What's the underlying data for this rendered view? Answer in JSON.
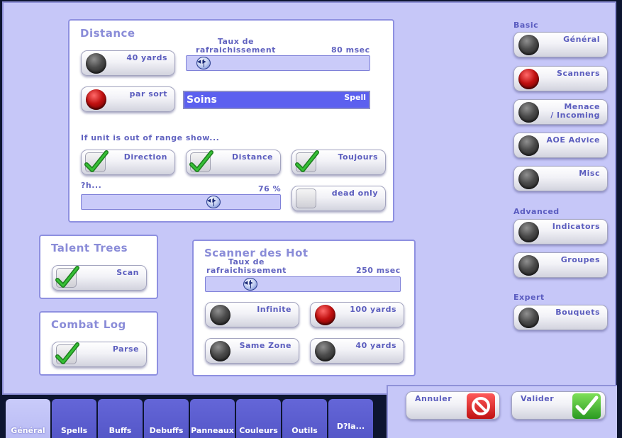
{
  "distance": {
    "title": "Distance",
    "btn_40yards": "40 yards",
    "btn_par_sort": "par sort",
    "refresh_label": "Taux de\nrafraichissement",
    "refresh_value": "80 msec",
    "refresh_level": 0.03,
    "spell_value": "Soins",
    "spell_tag": "Spell",
    "out_of_range_label": "If unit is out of range show...",
    "btn_direction": "Direction",
    "btn_distance": "Distance",
    "btn_toujours": "Toujours",
    "alpha_label": "?h...",
    "alpha_value": "76 %",
    "alpha_level": 0.76,
    "btn_dead_only": "dead only"
  },
  "talent_trees": {
    "title": "Talent Trees",
    "btn_scan": "Scan"
  },
  "combat_log": {
    "title": "Combat Log",
    "btn_parse": "Parse"
  },
  "scanner_hot": {
    "title": "Scanner des Hot",
    "refresh_label": "Taux de\nrafraichissement",
    "refresh_value": "250 msec",
    "refresh_level": 0.2,
    "btn_infinite": "Infinite",
    "btn_100yards": "100 yards",
    "btn_same_zone": "Same Zone",
    "btn_40yards": "40 yards"
  },
  "sidebar": {
    "basic_label": "Basic",
    "advanced_label": "Advanced",
    "expert_label": "Expert",
    "general": "Général",
    "scanners": "Scanners",
    "menace": "Menace\n/ Incoming",
    "aoe": "AOE Advice",
    "misc": "Misc",
    "indicators": "Indicators",
    "groupes": "Groupes",
    "bouquets": "Bouquets"
  },
  "footer": {
    "cancel": "Annuler",
    "validate": "Valider"
  },
  "tabs": [
    "Général",
    "Spells",
    "Buffs",
    "Debuffs",
    "Panneaux",
    "Couleurs",
    "Outils",
    "D?la..."
  ],
  "colors": {
    "panel_bg": "#c6c7f8",
    "accent": "#5b5dbe",
    "spell_bar": "#5c60ef"
  }
}
